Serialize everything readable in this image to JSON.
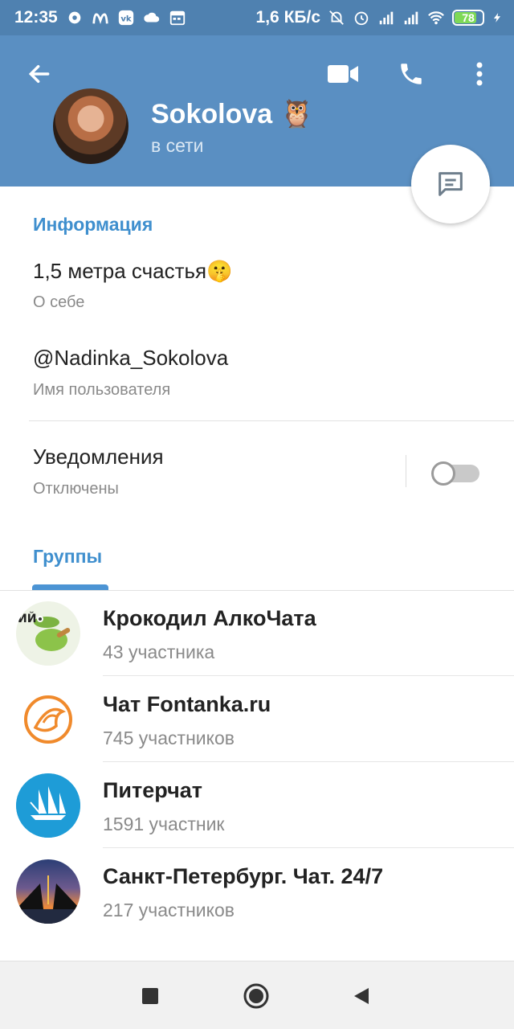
{
  "statusbar": {
    "time": "12:35",
    "net_speed": "1,6 КБ/с",
    "battery": "78",
    "icons": [
      "eye-icon",
      "mcdonalds-icon",
      "vk-icon",
      "cloud-icon",
      "calendar-icon",
      "mute-bell-icon",
      "alarm-icon",
      "signal-icon",
      "signal-icon",
      "wifi-icon",
      "battery-icon",
      "charging-icon"
    ]
  },
  "header": {
    "name": "Sokolova 🦉",
    "status": "в сети",
    "icons": {
      "back": "back-arrow-icon",
      "video": "video-camera-icon",
      "call": "phone-icon",
      "menu": "more-vertical-icon",
      "message": "message-icon"
    }
  },
  "info": {
    "title": "Информация",
    "bio": "1,5 метра счастья🤫",
    "bio_caption": "О себе",
    "username": "@Nadinka_Sokolova",
    "username_caption": "Имя пользователя",
    "notifications": "Уведомления",
    "notifications_state": "Отключены",
    "notifications_on": false
  },
  "groups": {
    "title": "Группы",
    "items": [
      {
        "name": "Крокодил АлкоЧата",
        "members": "43 участника"
      },
      {
        "name": "Чат Fontanka.ru",
        "members": "745 участников"
      },
      {
        "name": "Питерчат",
        "members": "1591 участник"
      },
      {
        "name": "Санкт-Петербург. Чат. 24/7",
        "members": "217 участников"
      }
    ]
  },
  "colors": {
    "header": "#5a8fc2",
    "statusbar": "#4f81b0",
    "accent": "#3f8fce"
  }
}
